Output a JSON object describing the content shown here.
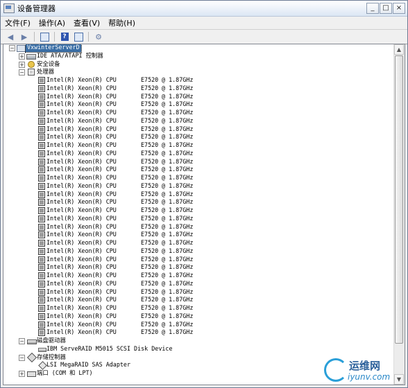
{
  "window": {
    "title": "设备管理器",
    "controls": [
      "_",
      "□",
      "×"
    ]
  },
  "menu": [
    {
      "label": "文件(F)"
    },
    {
      "label": "操作(A)"
    },
    {
      "label": "查看(V)"
    },
    {
      "label": "帮助(H)"
    }
  ],
  "toolbar": {
    "icons": [
      "back-arrow-icon",
      "forward-arrow-icon",
      "properties-icon",
      "help-icon",
      "update-driver-icon",
      "scan-hardware-icon"
    ]
  },
  "tree": {
    "root": "VxwinterServerD",
    "categories": {
      "ide": "IDE ATA/ATAPI 控制器",
      "security": "安全设备",
      "processors": "处理器",
      "disk": "磁盘驱动器",
      "storage": "存储控制器",
      "ports": "端口 (COM 和 LPT)"
    },
    "cpu": {
      "name": "Intel(R) Xeon(R) CPU",
      "model": "E7520",
      "freq": "@ 1.87GHz",
      "count": 32
    },
    "disk_device": "IBM ServeRAID M5015 SCSI Disk Device",
    "storage_device": "LSI MegaRAID SAS Adapter"
  },
  "watermark": {
    "cn": "运维网",
    "url": "iyunv.com"
  }
}
